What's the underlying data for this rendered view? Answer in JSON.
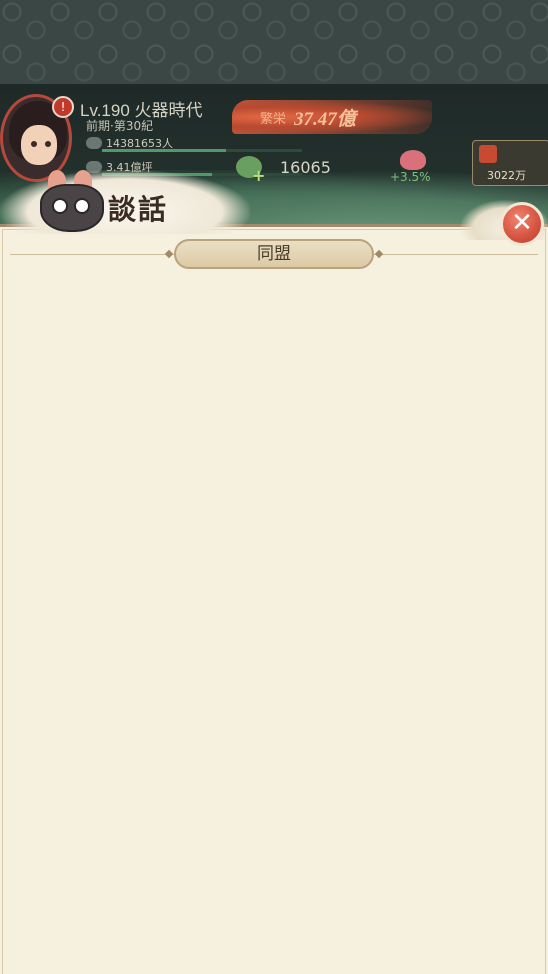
{
  "player": {
    "level_text": "Lv.190 火器時代",
    "era_text": "前期·第30紀",
    "population": "14381653人",
    "population_progress": 0.62,
    "power": "3.41億坪",
    "power_progress": 0.55
  },
  "resources": {
    "gold_label": "繁栄",
    "gold_value": "37.47億",
    "frog_value": "16065",
    "lotus_value": "+3.5%",
    "shop_value": "3022万"
  },
  "dialog": {
    "title": "談話",
    "active_tab": "同盟",
    "close_symbol": "✕"
  },
  "icons": {
    "alert": "alert-icon",
    "avatar": "avatar",
    "close": "close-icon",
    "frog": "frog-icon",
    "lotus": "lotus-icon",
    "mascot": "dragon-mascot-icon"
  },
  "colors": {
    "dialog_bg": "#f6f0de",
    "close_red": "#d5523f",
    "flame": "#b74a31"
  }
}
